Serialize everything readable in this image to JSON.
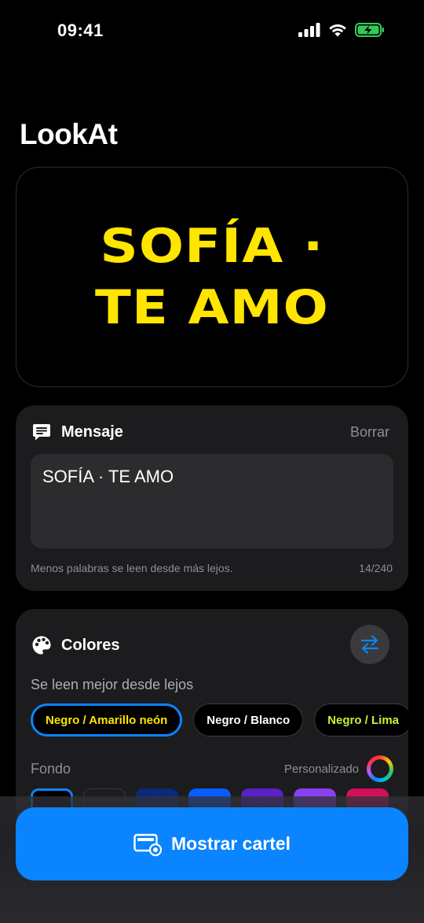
{
  "status": {
    "time": "09:41"
  },
  "app": {
    "title": "LookAt"
  },
  "preview": {
    "text": "SOFÍA ·\nTE AMO",
    "text_color": "#ffe500",
    "background": "#000000"
  },
  "message": {
    "title": "Mensaje",
    "clear_label": "Borrar",
    "value": "SOFÍA · TE AMO",
    "hint": "Menos palabras se leen desde más lejos.",
    "char_count": "14/240",
    "icon": "message-bubble-icon"
  },
  "colors": {
    "title": "Colores",
    "icon": "palette-icon",
    "swap_icon": "swap-arrows-icon",
    "subtitle": "Se leen mejor desde lejos",
    "presets": [
      {
        "label": "Negro / Amarillo neón",
        "text_color": "#ffe500",
        "selected": true
      },
      {
        "label": "Negro / Blanco",
        "text_color": "#ffffff",
        "selected": false
      },
      {
        "label": "Negro / Lima",
        "text_color": "#c6f432",
        "selected": false
      }
    ],
    "background_label": "Fondo",
    "custom_label": "Personalizado",
    "swatches": [
      "#000000",
      "#1c1c1e",
      "#0a2a7a",
      "#0a5cff",
      "#5b21c9",
      "#8a3ff0",
      "#d0105a"
    ]
  },
  "cta": {
    "label": "Mostrar cartel",
    "color": "#0a84ff",
    "icon": "display-sign-icon"
  }
}
